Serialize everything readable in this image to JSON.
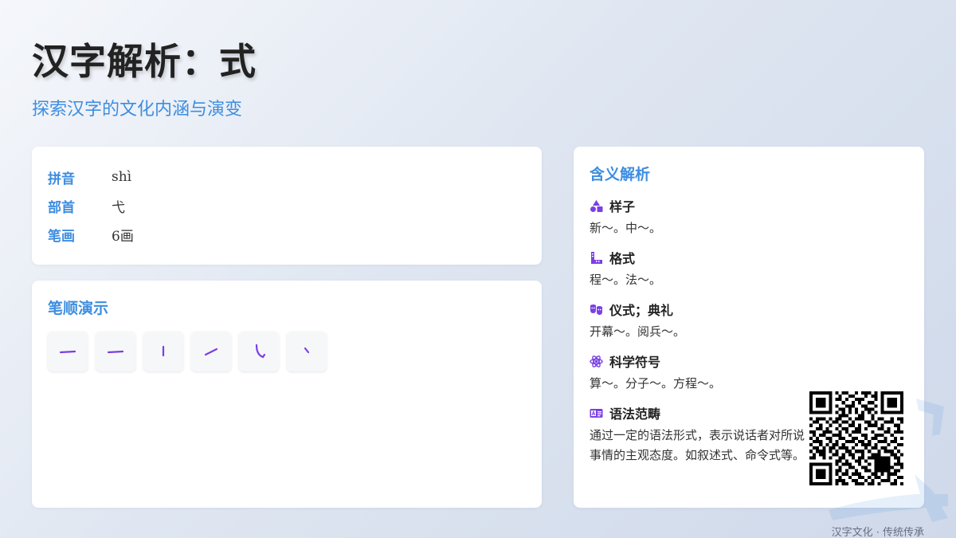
{
  "header": {
    "title": "汉字解析：式",
    "subtitle": "探索汉字的文化内涵与演变"
  },
  "info": {
    "rows": [
      {
        "label": "拼音",
        "value": "shì"
      },
      {
        "label": "部首",
        "value": "弋"
      },
      {
        "label": "笔画",
        "value": "6画"
      }
    ]
  },
  "strokes": {
    "title": "笔顺演示",
    "items": [
      "heng-stroke",
      "heng-stroke",
      "shu-stroke",
      "ti-stroke",
      "xiegou-stroke",
      "dian-stroke"
    ]
  },
  "meanings": {
    "title": "含义解析",
    "items": [
      {
        "icon": "shapes-icon",
        "term": "样子",
        "example": "新～。中～。"
      },
      {
        "icon": "ruler-icon",
        "term": "格式",
        "example": "程～。法～。"
      },
      {
        "icon": "masks-icon",
        "term": "仪式；典礼",
        "example": "开幕～。阅兵～。"
      },
      {
        "icon": "atom-icon",
        "term": "科学符号",
        "example": "算～。分子～。方程～。"
      },
      {
        "icon": "id-card-icon",
        "term": "语法范畴",
        "example": "通过一定的语法形式，表示说话者对所说事情的主观态度。如叙述式、命令式等。"
      }
    ]
  },
  "footer": {
    "text": "汉字文化 · 传统传承"
  },
  "colors": {
    "accent": "#3d8de0",
    "stroke": "#7b3fe4",
    "icon": "#7b3fe4"
  }
}
